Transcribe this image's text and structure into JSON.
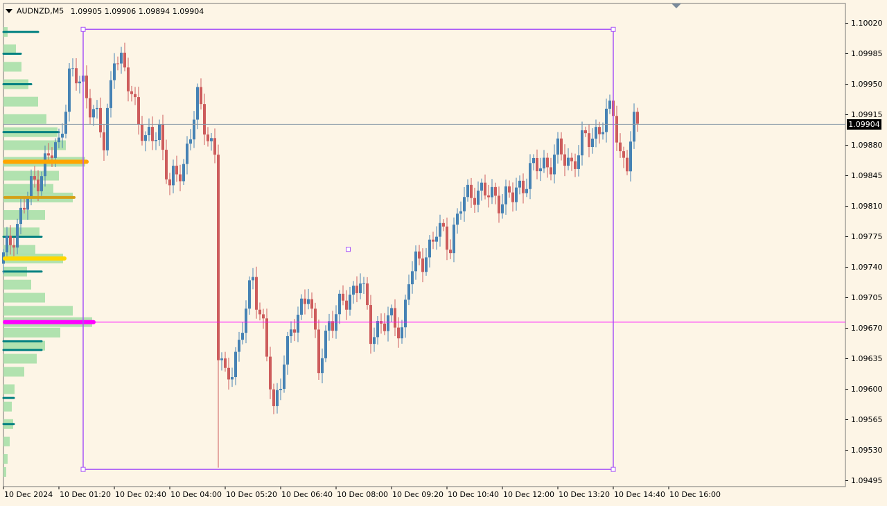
{
  "header": {
    "symbol": "AUDNZD,M5",
    "ohlc": "1.09905 1.09906 1.09894 1.09904"
  },
  "price_axis": {
    "labels": [
      "1.10020",
      "1.09985",
      "1.09950",
      "1.09915",
      "1.09880",
      "1.09845",
      "1.09810",
      "1.09775",
      "1.09740",
      "1.09705",
      "1.09670",
      "1.09635",
      "1.09600",
      "1.09565",
      "1.09530",
      "1.09495"
    ],
    "current_price": "1.09904"
  },
  "time_axis": {
    "labels": [
      "10 Dec 2024",
      "10 Dec 01:20",
      "10 Dec 02:40",
      "10 Dec 04:00",
      "10 Dec 05:20",
      "10 Dec 06:40",
      "10 Dec 08:00",
      "10 Dec 09:20",
      "10 Dec 10:40",
      "10 Dec 12:00",
      "10 Dec 13:20",
      "10 Dec 14:40",
      "10 Dec 16:00"
    ]
  },
  "colors": {
    "background": "#fdf5e6",
    "bull": "#4682b4",
    "bear": "#cd5c5c",
    "box": "#a855f7",
    "poc_line": "#ff00ff",
    "price_line": "#8a9aa8",
    "profile": "#a8e0a8",
    "level_teal": "#008080",
    "level_orange": "#ffa500",
    "level_gold": "#d4a017",
    "level_yellow": "#ffd700"
  },
  "chart_data": {
    "type": "candlestick",
    "title": "",
    "symbol": "AUDNZD",
    "timeframe": "M5",
    "ylim": [
      1.09485,
      1.1004
    ],
    "current_price": 1.09904,
    "poc_price": 1.09677,
    "box": {
      "from": "10 Dec 01:55",
      "to": "10 Dec 14:40",
      "high": 1.10013,
      "low": 1.09508
    },
    "levels": [
      {
        "price": 1.09861,
        "color": "orange"
      },
      {
        "price": 1.0982,
        "color": "gold"
      },
      {
        "price": 1.0975,
        "color": "yellow"
      },
      {
        "price": 1.09677,
        "color": "magenta"
      }
    ],
    "anchors": [
      {
        "time": "10 Dec 00:00",
        "close": 1.0975
      },
      {
        "time": "10 Dec 00:20",
        "close": 1.0979
      },
      {
        "time": "10 Dec 00:40",
        "close": 1.0983
      },
      {
        "time": "10 Dec 01:00",
        "close": 1.0986
      },
      {
        "time": "10 Dec 01:20",
        "close": 1.0988
      },
      {
        "time": "10 Dec 01:35",
        "close": 1.0996
      },
      {
        "time": "10 Dec 01:55",
        "close": 1.0995
      },
      {
        "time": "10 Dec 02:10",
        "close": 1.0992
      },
      {
        "time": "10 Dec 02:25",
        "close": 1.0988
      },
      {
        "time": "10 Dec 02:40",
        "close": 1.0999
      },
      {
        "time": "10 Dec 02:55",
        "close": 1.0996
      },
      {
        "time": "10 Dec 03:10",
        "close": 1.0993
      },
      {
        "time": "10 Dec 03:25",
        "close": 1.0988
      },
      {
        "time": "10 Dec 03:45",
        "close": 1.099
      },
      {
        "time": "10 Dec 04:00",
        "close": 1.0983
      },
      {
        "time": "10 Dec 04:20",
        "close": 1.0986
      },
      {
        "time": "10 Dec 04:40",
        "close": 1.0993
      },
      {
        "time": "10 Dec 05:05",
        "close": 1.0987
      },
      {
        "time": "10 Dec 05:10",
        "close": 1.0964
      },
      {
        "time": "10 Dec 05:20",
        "close": 1.0961
      },
      {
        "time": "10 Dec 05:40",
        "close": 1.0965
      },
      {
        "time": "10 Dec 06:00",
        "close": 1.0973
      },
      {
        "time": "10 Dec 06:15",
        "close": 1.0967
      },
      {
        "time": "10 Dec 06:30",
        "close": 1.0957
      },
      {
        "time": "10 Dec 06:45",
        "close": 1.0964
      },
      {
        "time": "10 Dec 07:00",
        "close": 1.0967
      },
      {
        "time": "10 Dec 07:20",
        "close": 1.0972
      },
      {
        "time": "10 Dec 07:35",
        "close": 1.0962
      },
      {
        "time": "10 Dec 07:50",
        "close": 1.0968
      },
      {
        "time": "10 Dec 08:15",
        "close": 1.097
      },
      {
        "time": "10 Dec 08:35",
        "close": 1.0973
      },
      {
        "time": "10 Dec 08:50",
        "close": 1.0966
      },
      {
        "time": "10 Dec 09:05",
        "close": 1.0968
      },
      {
        "time": "10 Dec 09:35",
        "close": 1.0967
      },
      {
        "time": "10 Dec 09:45",
        "close": 1.0973
      },
      {
        "time": "10 Dec 10:05",
        "close": 1.0975
      },
      {
        "time": "10 Dec 10:25",
        "close": 1.0978
      },
      {
        "time": "10 Dec 10:45",
        "close": 1.0977
      },
      {
        "time": "10 Dec 11:00",
        "close": 1.0981
      },
      {
        "time": "10 Dec 11:20",
        "close": 1.0983
      },
      {
        "time": "10 Dec 11:45",
        "close": 1.0982
      },
      {
        "time": "10 Dec 12:00",
        "close": 1.0982
      },
      {
        "time": "10 Dec 12:15",
        "close": 1.0982
      },
      {
        "time": "10 Dec 12:40",
        "close": 1.0985
      },
      {
        "time": "10 Dec 13:05",
        "close": 1.0986
      },
      {
        "time": "10 Dec 13:20",
        "close": 1.0987
      },
      {
        "time": "10 Dec 13:40",
        "close": 1.0986
      },
      {
        "time": "10 Dec 13:55",
        "close": 1.0988
      },
      {
        "time": "10 Dec 14:20",
        "close": 1.099
      },
      {
        "time": "10 Dec 14:40",
        "close": 1.0992
      },
      {
        "time": "10 Dec 14:50",
        "close": 1.0987
      },
      {
        "time": "10 Dec 15:00",
        "close": 1.0986
      },
      {
        "time": "10 Dec 15:10",
        "close": 1.099
      },
      {
        "time": "10 Dec 15:15",
        "close": 1.09904
      }
    ],
    "volume_profile": [
      {
        "price": 1.1001,
        "volume": 6
      },
      {
        "price": 1.0999,
        "volume": 18
      },
      {
        "price": 1.0997,
        "volume": 26
      },
      {
        "price": 1.0995,
        "volume": 36
      },
      {
        "price": 1.0993,
        "volume": 50
      },
      {
        "price": 1.0991,
        "volume": 62
      },
      {
        "price": 1.09895,
        "volume": 78
      },
      {
        "price": 1.0988,
        "volume": 90
      },
      {
        "price": 1.09861,
        "volume": 118
      },
      {
        "price": 1.09845,
        "volume": 80
      },
      {
        "price": 1.0983,
        "volume": 72
      },
      {
        "price": 1.0982,
        "volume": 100
      },
      {
        "price": 1.098,
        "volume": 60
      },
      {
        "price": 1.0978,
        "volume": 52
      },
      {
        "price": 1.0976,
        "volume": 46
      },
      {
        "price": 1.0975,
        "volume": 86
      },
      {
        "price": 1.09735,
        "volume": 34
      },
      {
        "price": 1.0972,
        "volume": 40
      },
      {
        "price": 1.09705,
        "volume": 60
      },
      {
        "price": 1.0969,
        "volume": 100
      },
      {
        "price": 1.09677,
        "volume": 128
      },
      {
        "price": 1.09665,
        "volume": 82
      },
      {
        "price": 1.0965,
        "volume": 60
      },
      {
        "price": 1.09635,
        "volume": 48
      },
      {
        "price": 1.0962,
        "volume": 30
      },
      {
        "price": 1.096,
        "volume": 16
      },
      {
        "price": 1.0958,
        "volume": 12
      },
      {
        "price": 1.0956,
        "volume": 14
      },
      {
        "price": 1.0954,
        "volume": 9
      },
      {
        "price": 1.0952,
        "volume": 6
      },
      {
        "price": 1.09505,
        "volume": 4
      }
    ]
  }
}
